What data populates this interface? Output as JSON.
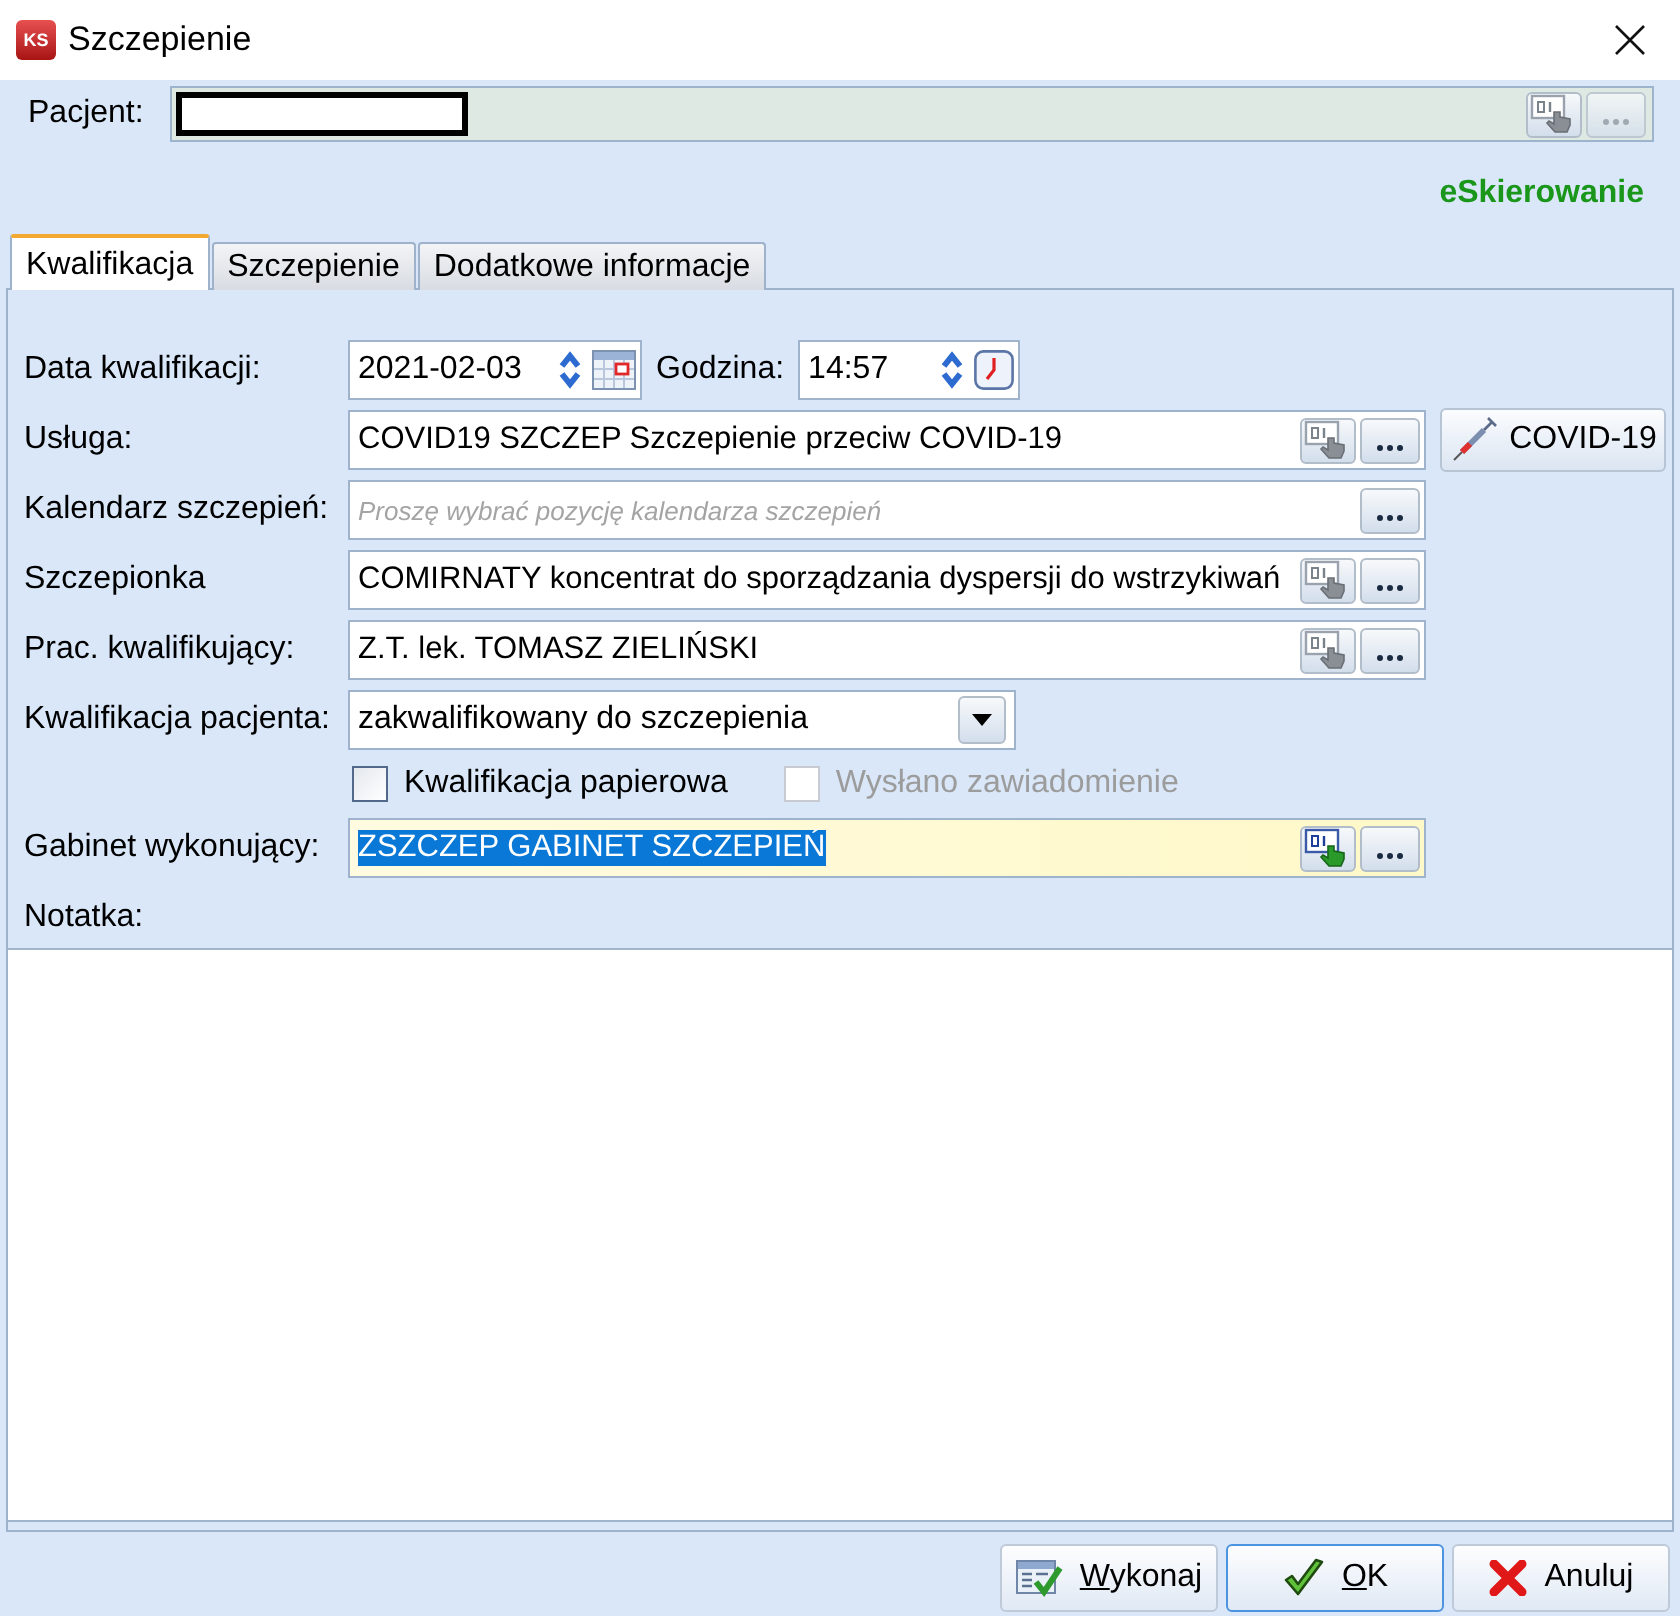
{
  "window": {
    "logo": "KS",
    "title": "Szczepienie"
  },
  "patient": {
    "label": "Pacjent:",
    "disabled": true
  },
  "referral": {
    "label": "eSkierowanie"
  },
  "tabs": [
    {
      "label": "Kwalifikacja",
      "selected": true
    },
    {
      "label": "Szczepienie",
      "selected": false
    },
    {
      "label": "Dodatkowe informacje",
      "selected": false
    }
  ],
  "form": {
    "fields": [
      {
        "kind": "datetime",
        "label": "Data kwalifikacji:",
        "date": "2021-02-03",
        "time_label": "Godzina:",
        "time": "14:57"
      },
      {
        "kind": "lookup",
        "label": "Usługa:",
        "value": "COVID19 SZCZEP Szczepienie przeciw COVID-19",
        "picker": true,
        "focused": false,
        "side_button": "COVID-19"
      },
      {
        "kind": "lookup",
        "label": "Kalendarz szczepień:",
        "placeholder": "Proszę wybrać pozycję kalendarza szczepień",
        "picker": false,
        "focused": false
      },
      {
        "kind": "lookup",
        "label": "Szczepionka",
        "value": "COMIRNATY koncentrat do sporządzania dyspersji do wstrzykiwań",
        "picker": true,
        "focused": false
      },
      {
        "kind": "lookup",
        "label": "Prac. kwalifikujący:",
        "value": "Z.T. lek. TOMASZ ZIELIŃSKI",
        "picker": true,
        "focused": false
      },
      {
        "kind": "dropdown",
        "label": "Kwalifikacja pacjenta:",
        "value": "zakwalifikowany do szczepienia"
      },
      {
        "kind": "checkboxes",
        "items": [
          {
            "label": "Kwalifikacja papierowa",
            "checked": false,
            "disabled": false
          },
          {
            "label": "Wysłano zawiadomienie",
            "checked": false,
            "disabled": true
          }
        ]
      },
      {
        "kind": "lookup",
        "label": "Gabinet wykonujący:",
        "value": "ZSZCZEP GABINET SZCZEPIEŃ",
        "picker": true,
        "focused": true
      }
    ],
    "note_label": "Notatka:"
  },
  "buttons": [
    {
      "kind": "execute",
      "label": "Wykonaj",
      "underline_first": true,
      "focused": false
    },
    {
      "kind": "ok",
      "label": "OK",
      "underline_first": true,
      "focused": true
    },
    {
      "kind": "cancel",
      "label": "Anuluj",
      "underline_first": false,
      "focused": false
    }
  ]
}
